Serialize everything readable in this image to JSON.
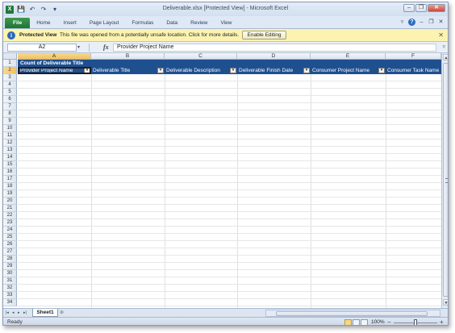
{
  "window": {
    "title": "Deliverable.xlsx  [Protected View]  -  Microsoft Excel",
    "app_icon_label": "X",
    "quick_access": {
      "save": "💾",
      "undo": "↶",
      "redo": "↷",
      "customize": "▾"
    },
    "controls": {
      "minimize": "–",
      "restore": "❐",
      "close": "✕"
    }
  },
  "ribbon": {
    "tabs": [
      "File",
      "Home",
      "Insert",
      "Page Layout",
      "Formulas",
      "Data",
      "Review",
      "View"
    ],
    "right_icons": {
      "minimize_ribbon": "▿",
      "help": "?",
      "doc_min": "–",
      "doc_restore": "❐",
      "doc_close": "✕"
    }
  },
  "protected_view": {
    "icon": "i",
    "title": "Protected View",
    "message": "This file was opened from a potentially unsafe location. Click for more details.",
    "button": "Enable Editing",
    "close": "✕"
  },
  "formula_bar": {
    "name_box": "A2",
    "fx": "fx",
    "content": "Provider Project Name"
  },
  "grid": {
    "columns": [
      "A",
      "B",
      "C",
      "D",
      "E",
      "F"
    ],
    "selected_column": "A",
    "rows": [
      "1",
      "2",
      "3",
      "4",
      "5",
      "6",
      "7",
      "8",
      "9",
      "10",
      "11",
      "12",
      "13",
      "14",
      "15",
      "16",
      "17",
      "18",
      "19",
      "20",
      "21",
      "22",
      "23",
      "24",
      "25",
      "26",
      "27",
      "28",
      "29",
      "30",
      "31",
      "32",
      "33",
      "34"
    ],
    "selected_row": "2",
    "pivot_title": "Count of Deliverable Title",
    "headers": [
      "Provider Project Name",
      "Deliverable Title",
      "Deliverable Description",
      "Deliverable Finish Date",
      "Consumer Project Name",
      "Consumer Task Name"
    ],
    "dropdown_glyph": "▾"
  },
  "sheets": {
    "nav": [
      "|◂",
      "◂",
      "▸",
      "▸|"
    ],
    "tabs": [
      "Sheet1"
    ],
    "insert": "⊕"
  },
  "status": {
    "ready": "Ready",
    "zoom": "100%",
    "zoom_minus": "−",
    "zoom_plus": "+"
  },
  "colors": {
    "pivot_header": "#1e4f8f",
    "selection": "#f1c05c",
    "file_tab": "#1e7434",
    "protected_bar": "#fcf3b0"
  }
}
